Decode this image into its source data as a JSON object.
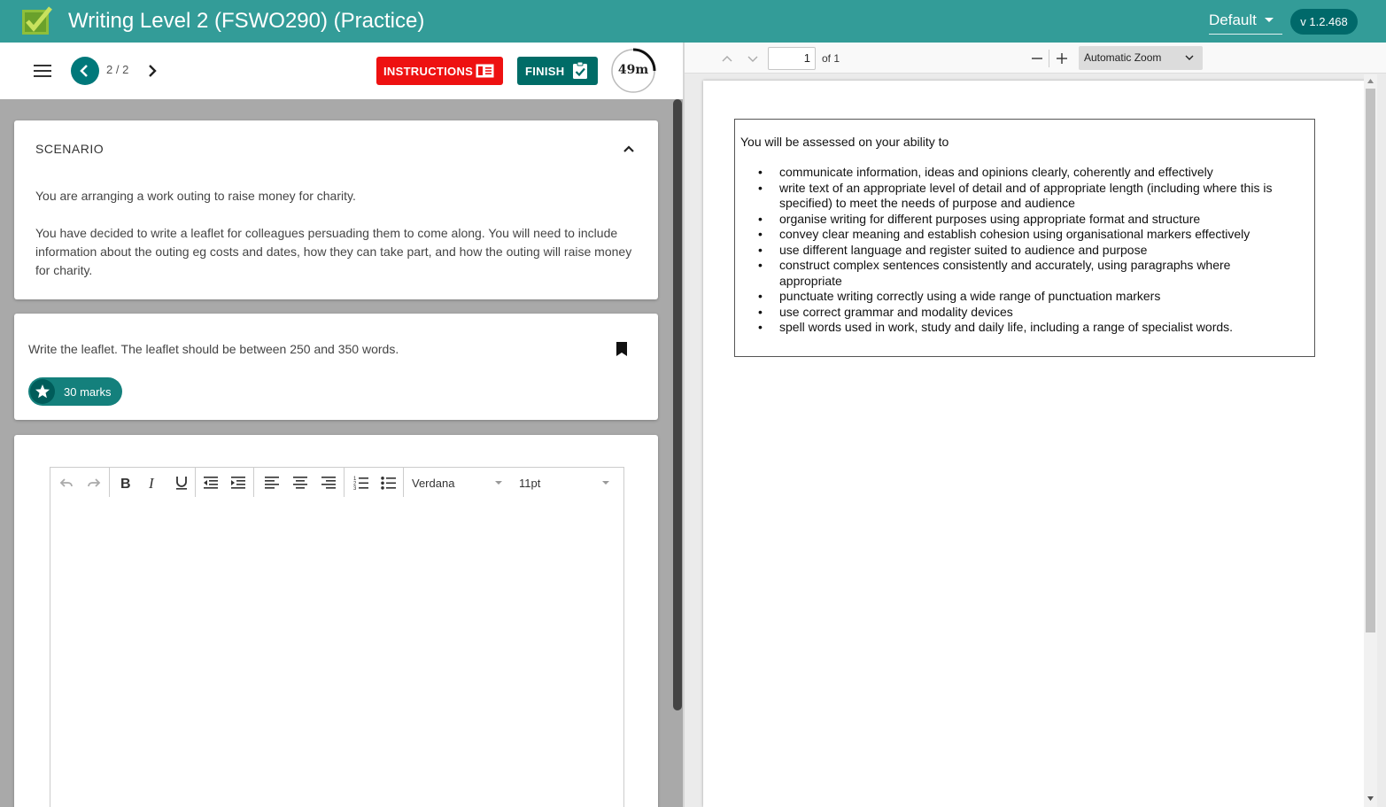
{
  "header": {
    "title": "Writing Level 2 (FSWO290) (Practice)",
    "theme": "Default",
    "version": "v 1.2.468",
    "brand_color": "#339c98"
  },
  "navigation": {
    "page_counter": "2 / 2",
    "instructions_label": "INSTRUCTIONS",
    "finish_label": "FINISH",
    "timer": "49m"
  },
  "scenario": {
    "title": "SCENARIO",
    "paragraph1": "You are arranging a work outing to raise money for charity.",
    "paragraph2": "You have decided to write a leaflet for colleagues persuading them to come along. You will need to include information about the outing eg costs and dates, how they can take part, and how the outing will raise money for charity."
  },
  "task": {
    "text": "Write the leaflet. The leaflet should be between 250 and 350 words.",
    "marks": "30 marks"
  },
  "editor": {
    "font": "Verdana",
    "size": "11pt",
    "content": ""
  },
  "pdf_viewer": {
    "page_number": "1",
    "page_total": "of 1",
    "zoom": "Automatic Zoom",
    "intro": "You will be assessed on your ability to",
    "criteria": [
      "communicate information, ideas and opinions clearly, coherently and effectively",
      "write text of an appropriate level of detail and of appropriate length (including where this is specified) to meet the needs of purpose and audience",
      "organise writing for different purposes using appropriate format and structure",
      "convey clear meaning and establish cohesion using organisational markers effectively",
      "use different language and register suited to audience and purpose",
      "construct complex sentences consistently and accurately, using paragraphs where appropriate",
      "punctuate writing correctly using a wide range of punctuation markers",
      "use correct grammar and modality devices",
      "spell words used in work, study and daily life, including a range of specialist words."
    ]
  }
}
